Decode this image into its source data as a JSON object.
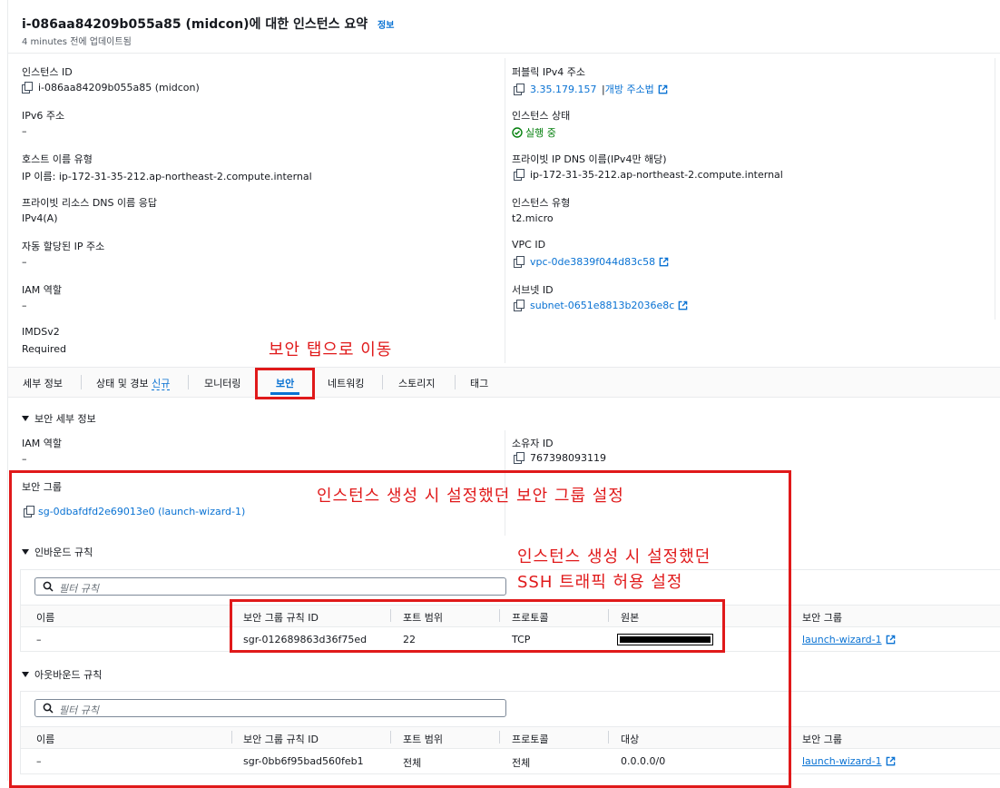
{
  "header": {
    "title": "i-086aa84209b055a85 (midcon)에 대한 인스턴스 요약",
    "info_link": "정보",
    "updated": "4 minutes 전에 업데이트됨"
  },
  "summary_left": [
    {
      "label": "인스턴스 ID",
      "value": "i-086aa84209b055a85 (midcon)",
      "copy": true
    },
    {
      "label": "IPv6 주소",
      "value": "–"
    },
    {
      "label": "호스트 이름 유형",
      "value": "IP 이름: ip-172-31-35-212.ap-northeast-2.compute.internal"
    },
    {
      "label": "프라이빗 리소스 DNS 이름 응답",
      "value": "IPv4(A)"
    },
    {
      "label": "자동 할당된 IP 주소",
      "value": "–"
    },
    {
      "label": "IAM 역할",
      "value": "–"
    },
    {
      "label": "IMDSv2",
      "value": "Required"
    }
  ],
  "summary_right": {
    "public_ipv4_label": "퍼블릭 IPv4 주소",
    "public_ipv4_value": "3.35.179.157",
    "public_ipv4_sep": "|",
    "open_address_link": "개방 주소법",
    "instance_state_label": "인스턴스 상태",
    "instance_state_value": "실행 중",
    "private_dns_label": "프라이빗 IP DNS 이름(IPv4만 해당)",
    "private_dns_value": "ip-172-31-35-212.ap-northeast-2.compute.internal",
    "instance_type_label": "인스턴스 유형",
    "instance_type_value": "t2.micro",
    "vpc_label": "VPC ID",
    "vpc_value": "vpc-0de3839f044d83c58",
    "subnet_label": "서브넷 ID",
    "subnet_value": "subnet-0651e8813b2036e8c"
  },
  "annotations": {
    "tab_note": "보안 탭으로 이동",
    "sg_note": "인스턴스 생성 시 설정했던 보안 그룹 설정",
    "ssh_note_line1": "인스턴스 생성 시 설정했던",
    "ssh_note_line2": "SSH 트래픽 허용 설정"
  },
  "tabs": {
    "details": "세부 정보",
    "status": "상태 및 경보",
    "status_new": "신규",
    "monitoring": "모니터링",
    "security": "보안",
    "networking": "네트워킹",
    "storage": "스토리지",
    "tags": "태그"
  },
  "security": {
    "section_title": "보안 세부 정보",
    "iam_label": "IAM 역할",
    "iam_value": "–",
    "owner_label": "소유자 ID",
    "owner_value": "767398093119",
    "sg_label": "보안 그룹",
    "sg_value": "sg-0dbafdfd2e69013e0 (launch-wizard-1)"
  },
  "inbound": {
    "title": "인바운드 규칙",
    "filter_placeholder": "필터 규칙",
    "headers": [
      "이름",
      "보안 그룹 규칙 ID",
      "포트 범위",
      "프로토콜",
      "원본",
      "보안 그룹"
    ],
    "row": {
      "name": "–",
      "rule_id": "sgr-012689863d36f75ed",
      "port": "22",
      "protocol": "TCP",
      "source": "",
      "sg": "launch-wizard-1"
    }
  },
  "outbound": {
    "title": "아웃바운드 규칙",
    "filter_placeholder": "필터 규칙",
    "headers": [
      "이름",
      "보안 그룹 규칙 ID",
      "포트 범위",
      "프로토콜",
      "대상",
      "보안 그룹"
    ],
    "row": {
      "name": "–",
      "rule_id": "sgr-0bb6f95bad560feb1",
      "port": "전체",
      "protocol": "전체",
      "dest": "0.0.0.0/0",
      "sg": "launch-wizard-1"
    }
  },
  "colors": {
    "link": "#0972d3",
    "success": "#037f0c",
    "annotation_red": "#e0191a"
  }
}
